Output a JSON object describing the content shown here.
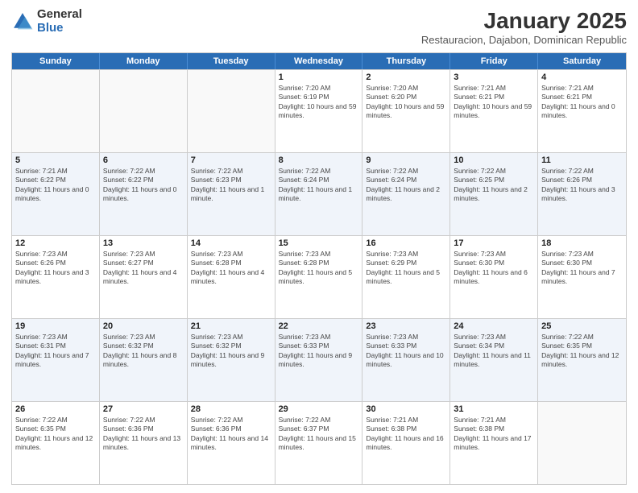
{
  "logo": {
    "general": "General",
    "blue": "Blue"
  },
  "title": "January 2025",
  "subtitle": "Restauracion, Dajabon, Dominican Republic",
  "days_of_week": [
    "Sunday",
    "Monday",
    "Tuesday",
    "Wednesday",
    "Thursday",
    "Friday",
    "Saturday"
  ],
  "weeks": [
    [
      {
        "day": "",
        "sunrise": "",
        "sunset": "",
        "daylight": "",
        "empty": true
      },
      {
        "day": "",
        "sunrise": "",
        "sunset": "",
        "daylight": "",
        "empty": true
      },
      {
        "day": "",
        "sunrise": "",
        "sunset": "",
        "daylight": "",
        "empty": true
      },
      {
        "day": "1",
        "sunrise": "Sunrise: 7:20 AM",
        "sunset": "Sunset: 6:19 PM",
        "daylight": "Daylight: 10 hours and 59 minutes.",
        "empty": false
      },
      {
        "day": "2",
        "sunrise": "Sunrise: 7:20 AM",
        "sunset": "Sunset: 6:20 PM",
        "daylight": "Daylight: 10 hours and 59 minutes.",
        "empty": false
      },
      {
        "day": "3",
        "sunrise": "Sunrise: 7:21 AM",
        "sunset": "Sunset: 6:21 PM",
        "daylight": "Daylight: 10 hours and 59 minutes.",
        "empty": false
      },
      {
        "day": "4",
        "sunrise": "Sunrise: 7:21 AM",
        "sunset": "Sunset: 6:21 PM",
        "daylight": "Daylight: 11 hours and 0 minutes.",
        "empty": false
      }
    ],
    [
      {
        "day": "5",
        "sunrise": "Sunrise: 7:21 AM",
        "sunset": "Sunset: 6:22 PM",
        "daylight": "Daylight: 11 hours and 0 minutes.",
        "empty": false
      },
      {
        "day": "6",
        "sunrise": "Sunrise: 7:22 AM",
        "sunset": "Sunset: 6:22 PM",
        "daylight": "Daylight: 11 hours and 0 minutes.",
        "empty": false
      },
      {
        "day": "7",
        "sunrise": "Sunrise: 7:22 AM",
        "sunset": "Sunset: 6:23 PM",
        "daylight": "Daylight: 11 hours and 1 minute.",
        "empty": false
      },
      {
        "day": "8",
        "sunrise": "Sunrise: 7:22 AM",
        "sunset": "Sunset: 6:24 PM",
        "daylight": "Daylight: 11 hours and 1 minute.",
        "empty": false
      },
      {
        "day": "9",
        "sunrise": "Sunrise: 7:22 AM",
        "sunset": "Sunset: 6:24 PM",
        "daylight": "Daylight: 11 hours and 2 minutes.",
        "empty": false
      },
      {
        "day": "10",
        "sunrise": "Sunrise: 7:22 AM",
        "sunset": "Sunset: 6:25 PM",
        "daylight": "Daylight: 11 hours and 2 minutes.",
        "empty": false
      },
      {
        "day": "11",
        "sunrise": "Sunrise: 7:22 AM",
        "sunset": "Sunset: 6:26 PM",
        "daylight": "Daylight: 11 hours and 3 minutes.",
        "empty": false
      }
    ],
    [
      {
        "day": "12",
        "sunrise": "Sunrise: 7:23 AM",
        "sunset": "Sunset: 6:26 PM",
        "daylight": "Daylight: 11 hours and 3 minutes.",
        "empty": false
      },
      {
        "day": "13",
        "sunrise": "Sunrise: 7:23 AM",
        "sunset": "Sunset: 6:27 PM",
        "daylight": "Daylight: 11 hours and 4 minutes.",
        "empty": false
      },
      {
        "day": "14",
        "sunrise": "Sunrise: 7:23 AM",
        "sunset": "Sunset: 6:28 PM",
        "daylight": "Daylight: 11 hours and 4 minutes.",
        "empty": false
      },
      {
        "day": "15",
        "sunrise": "Sunrise: 7:23 AM",
        "sunset": "Sunset: 6:28 PM",
        "daylight": "Daylight: 11 hours and 5 minutes.",
        "empty": false
      },
      {
        "day": "16",
        "sunrise": "Sunrise: 7:23 AM",
        "sunset": "Sunset: 6:29 PM",
        "daylight": "Daylight: 11 hours and 5 minutes.",
        "empty": false
      },
      {
        "day": "17",
        "sunrise": "Sunrise: 7:23 AM",
        "sunset": "Sunset: 6:30 PM",
        "daylight": "Daylight: 11 hours and 6 minutes.",
        "empty": false
      },
      {
        "day": "18",
        "sunrise": "Sunrise: 7:23 AM",
        "sunset": "Sunset: 6:30 PM",
        "daylight": "Daylight: 11 hours and 7 minutes.",
        "empty": false
      }
    ],
    [
      {
        "day": "19",
        "sunrise": "Sunrise: 7:23 AM",
        "sunset": "Sunset: 6:31 PM",
        "daylight": "Daylight: 11 hours and 7 minutes.",
        "empty": false
      },
      {
        "day": "20",
        "sunrise": "Sunrise: 7:23 AM",
        "sunset": "Sunset: 6:32 PM",
        "daylight": "Daylight: 11 hours and 8 minutes.",
        "empty": false
      },
      {
        "day": "21",
        "sunrise": "Sunrise: 7:23 AM",
        "sunset": "Sunset: 6:32 PM",
        "daylight": "Daylight: 11 hours and 9 minutes.",
        "empty": false
      },
      {
        "day": "22",
        "sunrise": "Sunrise: 7:23 AM",
        "sunset": "Sunset: 6:33 PM",
        "daylight": "Daylight: 11 hours and 9 minutes.",
        "empty": false
      },
      {
        "day": "23",
        "sunrise": "Sunrise: 7:23 AM",
        "sunset": "Sunset: 6:33 PM",
        "daylight": "Daylight: 11 hours and 10 minutes.",
        "empty": false
      },
      {
        "day": "24",
        "sunrise": "Sunrise: 7:23 AM",
        "sunset": "Sunset: 6:34 PM",
        "daylight": "Daylight: 11 hours and 11 minutes.",
        "empty": false
      },
      {
        "day": "25",
        "sunrise": "Sunrise: 7:22 AM",
        "sunset": "Sunset: 6:35 PM",
        "daylight": "Daylight: 11 hours and 12 minutes.",
        "empty": false
      }
    ],
    [
      {
        "day": "26",
        "sunrise": "Sunrise: 7:22 AM",
        "sunset": "Sunset: 6:35 PM",
        "daylight": "Daylight: 11 hours and 12 minutes.",
        "empty": false
      },
      {
        "day": "27",
        "sunrise": "Sunrise: 7:22 AM",
        "sunset": "Sunset: 6:36 PM",
        "daylight": "Daylight: 11 hours and 13 minutes.",
        "empty": false
      },
      {
        "day": "28",
        "sunrise": "Sunrise: 7:22 AM",
        "sunset": "Sunset: 6:36 PM",
        "daylight": "Daylight: 11 hours and 14 minutes.",
        "empty": false
      },
      {
        "day": "29",
        "sunrise": "Sunrise: 7:22 AM",
        "sunset": "Sunset: 6:37 PM",
        "daylight": "Daylight: 11 hours and 15 minutes.",
        "empty": false
      },
      {
        "day": "30",
        "sunrise": "Sunrise: 7:21 AM",
        "sunset": "Sunset: 6:38 PM",
        "daylight": "Daylight: 11 hours and 16 minutes.",
        "empty": false
      },
      {
        "day": "31",
        "sunrise": "Sunrise: 7:21 AM",
        "sunset": "Sunset: 6:38 PM",
        "daylight": "Daylight: 11 hours and 17 minutes.",
        "empty": false
      },
      {
        "day": "",
        "sunrise": "",
        "sunset": "",
        "daylight": "",
        "empty": true
      }
    ]
  ]
}
